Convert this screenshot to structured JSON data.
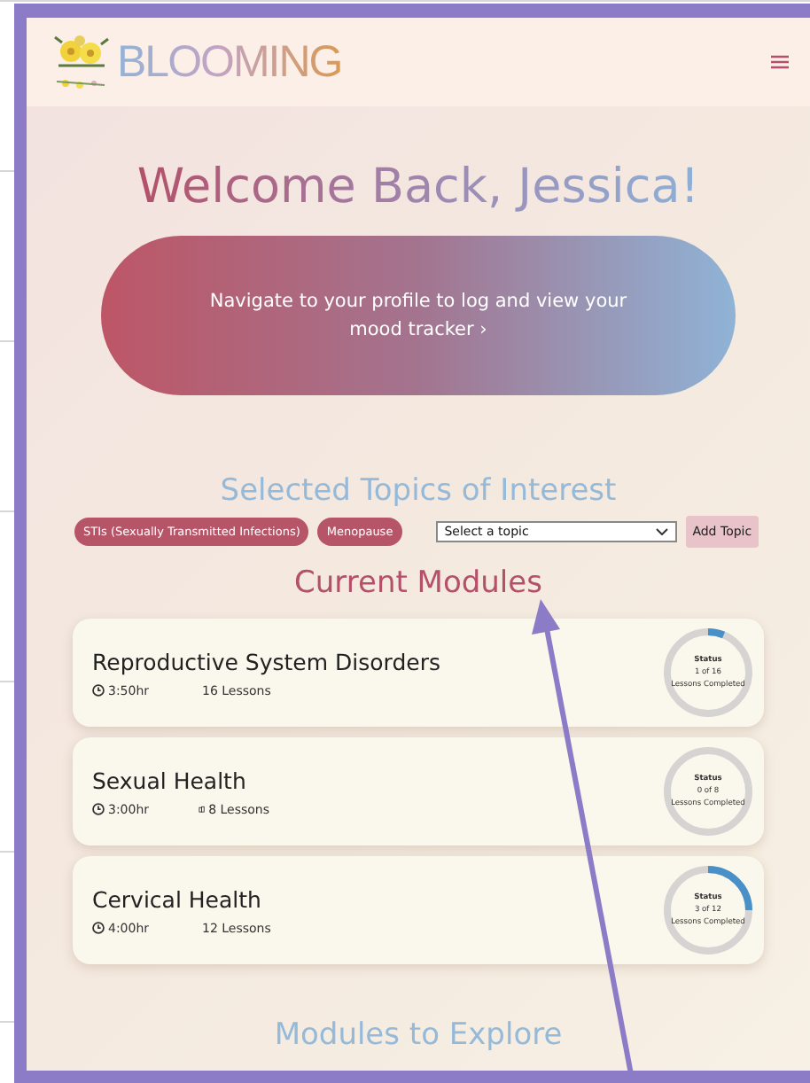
{
  "brand": {
    "name": "BLOOMING"
  },
  "welcome": "Welcome Back, Jessica!",
  "mood_banner": "Navigate to your profile to log and view your mood tracker ›",
  "topics": {
    "title": "Selected Topics of Interest",
    "selected": [
      "STIs (Sexually Transmitted Infections)",
      "Menopause"
    ],
    "select": {
      "value": "Select a topic"
    },
    "add_button": "Add Topic"
  },
  "current_modules": {
    "title": "Current Modules",
    "modules": [
      {
        "title": "Reproductive System Disorders",
        "duration": "3:50hr",
        "lessons": "16 Lessons",
        "status_label": "Status",
        "progress": "1 of 16",
        "progress_caption": "Lessons Completed",
        "level": 0.0625
      },
      {
        "title": "Sexual Health",
        "duration": "3:00hr",
        "lessons": "8 Lessons",
        "status_label": "Status",
        "progress": "0 of 8",
        "progress_caption": "Lessons Completed",
        "level": 0
      },
      {
        "title": "Cervical Health",
        "duration": "4:00hr",
        "lessons": "12 Lessons",
        "status_label": "Status",
        "progress": "3 of 12",
        "progress_caption": "Lessons Completed",
        "level": 0.25
      }
    ]
  },
  "explore": {
    "title": "Modules to Explore"
  }
}
